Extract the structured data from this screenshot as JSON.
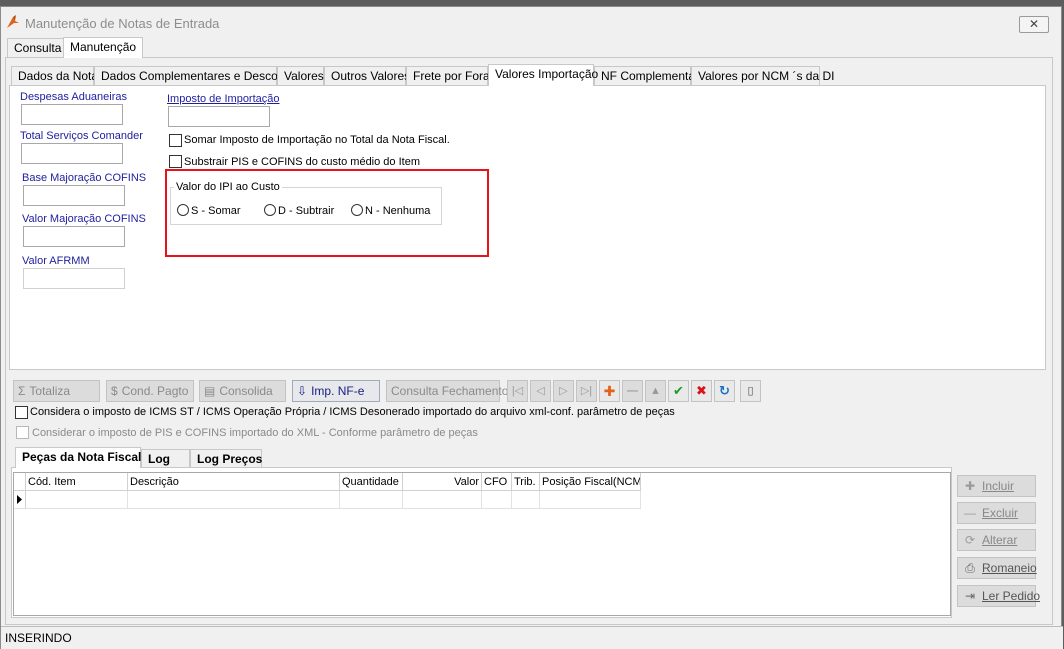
{
  "window": {
    "title": "Manutenção de Notas de Entrada",
    "close_label": "✕"
  },
  "outer_tabs": [
    "Consulta",
    "Manutenção"
  ],
  "inner_tabs": [
    "Dados da Nota",
    "Dados Complementares e Desconto",
    "Valores",
    "Outros Valores",
    "Frete por Fora",
    "Valores Importação",
    "NF Complementar",
    "Valores por NCM ´s da DI"
  ],
  "fields": {
    "despesas_aduaneiras": "Despesas Aduaneiras",
    "total_servicos": "Total Serviços Comander",
    "base_majoracao": "Base Majoração COFINS",
    "valor_majoracao": "Valor Majoração COFINS",
    "valor_afrmm": "Valor AFRMM",
    "imposto_importacao": "Imposto de Importação"
  },
  "checkboxes": {
    "somar_ii": "Somar Imposto de Importação no Total da Nota Fiscal.",
    "subtrair_pis": "Substrair PIS e COFINS do custo médio do Item",
    "considera_icms": "Considera o imposto de ICMS ST / ICMS Operação Própria / ICMS Desonerado importado do arquivo xml-conf. parâmetro de peças",
    "considerar_pis": "Considerar o imposto de PIS e COFINS importado do XML - Conforme parâmetro de peças"
  },
  "ipi_group": {
    "title": "Valor do IPI ao Custo",
    "options": [
      "S - Somar",
      "D - Subtrair",
      "N - Nenhuma"
    ]
  },
  "toolbar": {
    "totaliza": "Totaliza",
    "cond_pagto": "Cond. Pagto",
    "consolida": "Consolida",
    "imp_nfe": "Imp. NF-e",
    "consulta_fechamento": "Consulta Fechamento"
  },
  "bottom_tabs": [
    "Peças da Nota Fiscal",
    "Log",
    "Log Preços"
  ],
  "grid_columns": [
    "Cód. Item",
    "Descrição",
    "Quantidade",
    "Valor",
    "CFO",
    "Trib.",
    "Posição Fiscal(NCM)"
  ],
  "side_buttons": [
    "Incluir",
    "Excluir",
    "Alterar",
    "Romaneio",
    "Ler Pedido"
  ],
  "status": "INSERINDO",
  "colors": {
    "highlight_box": "#e8121a",
    "label_blue": "#1e1e9e",
    "confirm_green": "#1d9a2c",
    "cancel_red": "#d8131a",
    "refresh_blue": "#1b6fc2",
    "add_orange": "#e2611b"
  }
}
